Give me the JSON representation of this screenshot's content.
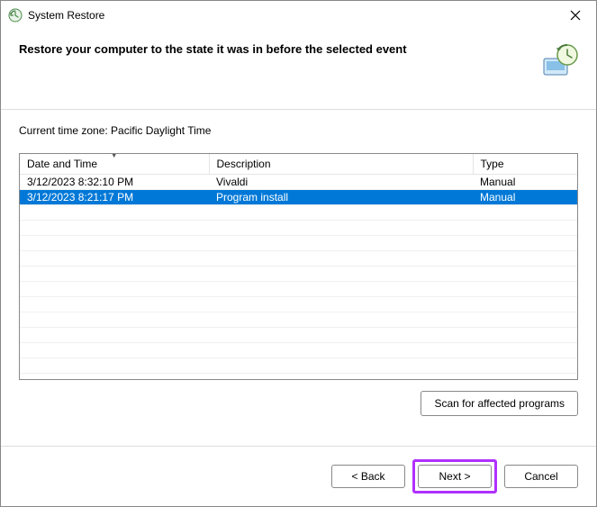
{
  "titlebar": {
    "title": "System Restore"
  },
  "header": {
    "heading": "Restore your computer to the state it was in before the selected event"
  },
  "timezone_label": "Current time zone: Pacific Daylight Time",
  "table": {
    "columns": {
      "date": "Date and Time",
      "description": "Description",
      "type": "Type"
    },
    "rows": [
      {
        "date": "3/12/2023 8:32:10 PM",
        "description": "Vivaldi",
        "type": "Manual",
        "selected": false
      },
      {
        "date": "3/12/2023 8:21:17 PM",
        "description": "Program install",
        "type": "Manual",
        "selected": true
      }
    ]
  },
  "buttons": {
    "scan": "Scan for affected programs",
    "back": "< Back",
    "next": "Next >",
    "cancel": "Cancel"
  }
}
